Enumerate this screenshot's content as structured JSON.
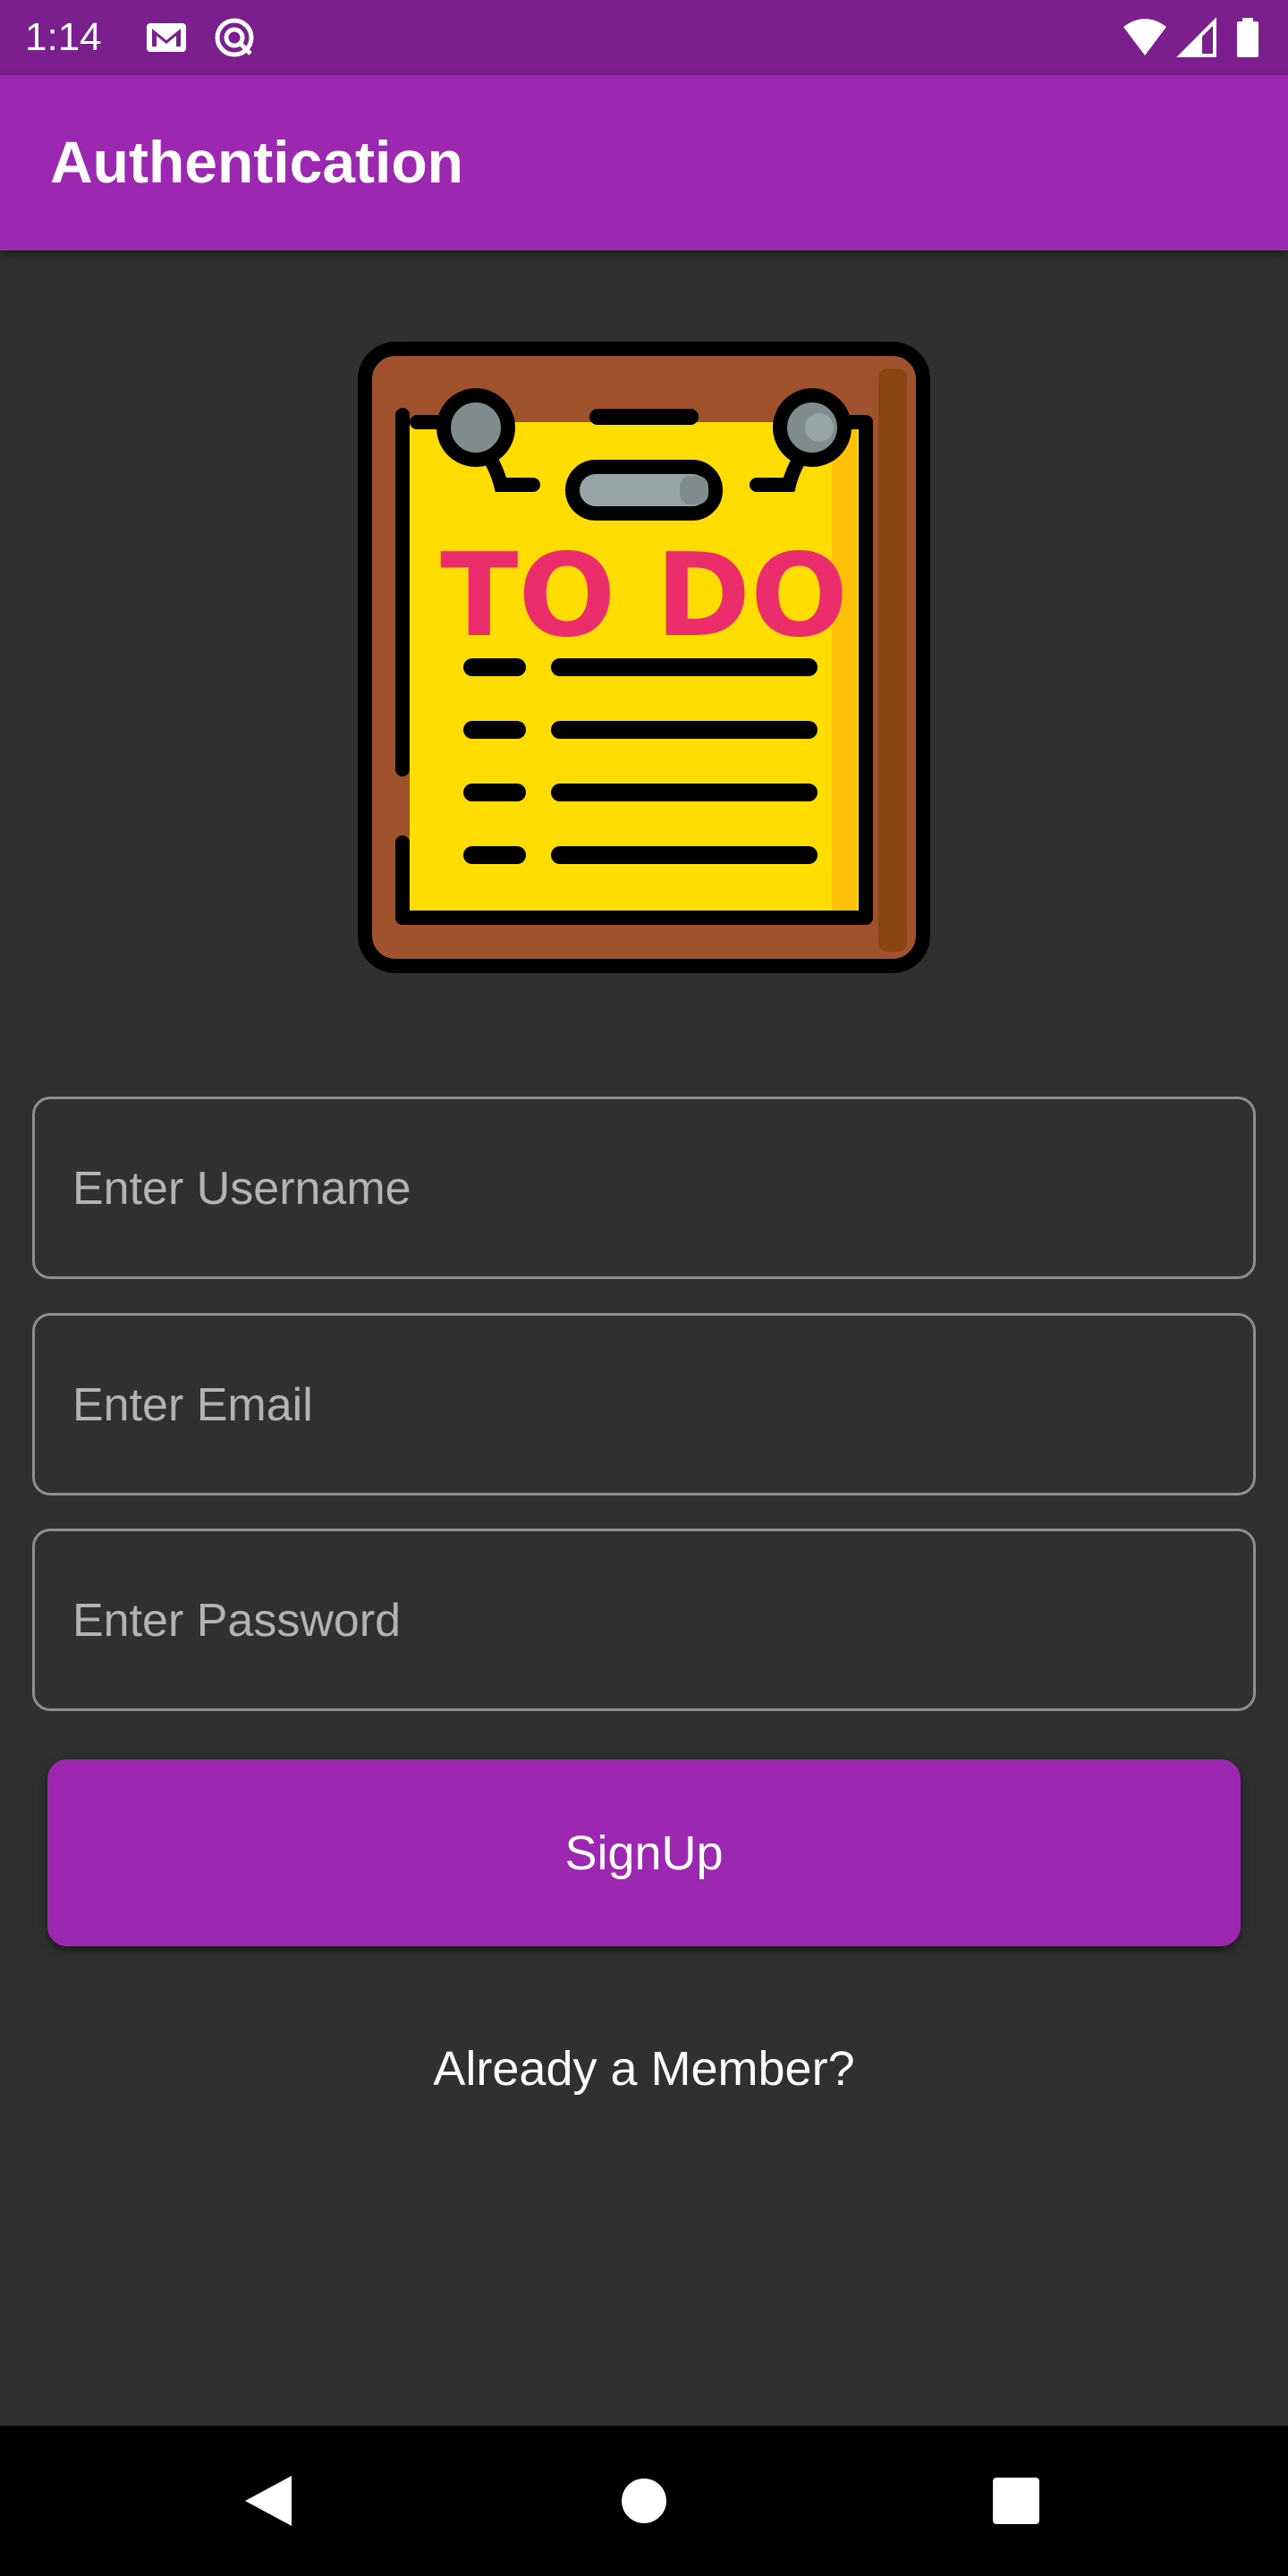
{
  "status_bar": {
    "time": "1:14",
    "icons": [
      "gmail-icon",
      "data-saver-icon",
      "wifi-icon",
      "cellular-signal-icon",
      "battery-icon"
    ]
  },
  "app_bar": {
    "title": "Authentication"
  },
  "logo": {
    "text": "TO DO"
  },
  "form": {
    "username_placeholder": "Enter Username",
    "email_placeholder": "Enter Email",
    "password_placeholder": "Enter Password",
    "signup_label": "SignUp",
    "member_link": "Already a Member?"
  },
  "nav_bar": {
    "icons": [
      "back-icon",
      "home-icon",
      "recents-icon"
    ]
  },
  "colors": {
    "status_bar": "#7b1f8f",
    "app_bar": "#9c27b0",
    "background": "#303030",
    "button": "#9c27b0",
    "logo_paper": "#ffdd00",
    "logo_board": "#a0522d",
    "logo_text": "#ec2d6b"
  }
}
